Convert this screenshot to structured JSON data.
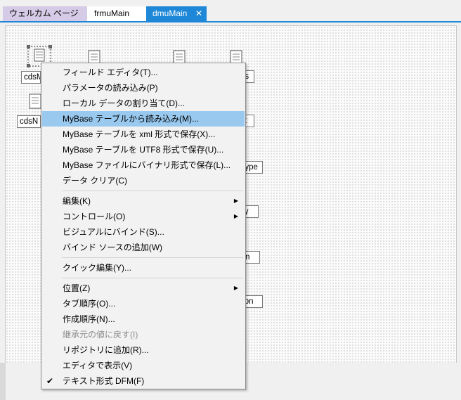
{
  "tabs": [
    {
      "label": "ウェルカム ページ"
    },
    {
      "label": "frmuMain"
    },
    {
      "label": "dmuMain",
      "close_glyph": "✕"
    }
  ],
  "components": [
    {
      "label": "cdsM"
    },
    {
      "label": "cdsN"
    },
    {
      "label": "us"
    },
    {
      "label": "ct"
    },
    {
      "label": "Type"
    },
    {
      "label": "ity"
    },
    {
      "label": "rm"
    },
    {
      "label": "tion"
    }
  ],
  "context_menu": {
    "items": [
      {
        "label": "フィールド エディタ(T)..."
      },
      {
        "label": "パラメータの読み込み(P)"
      },
      {
        "label": "ローカル データの割り当て(D)..."
      },
      {
        "label": "MyBase テーブルから読み込み(M)...",
        "highlighted": true
      },
      {
        "label": "MyBase テーブルを xml 形式で保存(X)..."
      },
      {
        "label": "MyBase テーブルを UTF8 形式で保存(U)..."
      },
      {
        "label": "MyBase ファイルにバイナリ形式で保存(L)..."
      },
      {
        "label": "データ クリア(C)"
      },
      {
        "label": "編集(K)",
        "submenu": true
      },
      {
        "label": "コントロール(O)",
        "submenu": true
      },
      {
        "label": "ビジュアルにバインド(S)..."
      },
      {
        "label": "バインド ソースの追加(W)"
      },
      {
        "label": "クイック編集(Y)..."
      },
      {
        "label": "位置(Z)",
        "submenu": true
      },
      {
        "label": "タブ順序(O)..."
      },
      {
        "label": "作成順序(N)..."
      },
      {
        "label": "継承元の値に戻す(I)",
        "disabled": true
      },
      {
        "label": "リポジトリに追加(R)..."
      },
      {
        "label": "エディタで表示(V)"
      },
      {
        "label": "テキスト形式 DFM(F)",
        "checked": true
      }
    ],
    "check_glyph": "✔",
    "submenu_glyph": "▶"
  },
  "colors": {
    "accent": "#1e87d8",
    "welcome_tab": "#d5cbe6",
    "menu_highlight": "#99c9ef"
  }
}
